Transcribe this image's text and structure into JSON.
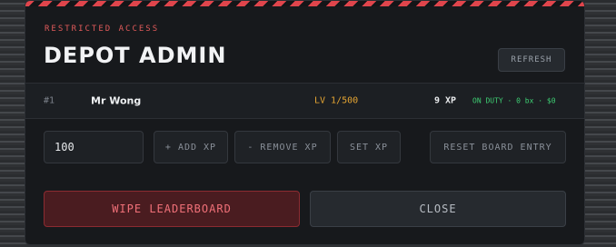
{
  "header": {
    "eyebrow": "RESTRICTED ACCESS",
    "title": "DEPOT ADMIN",
    "refresh_label": "REFRESH"
  },
  "entries": [
    {
      "rank": "#1",
      "name": "Mr Wong",
      "level": "LV 1/500",
      "xp": "9 XP",
      "status": "ON DUTY · 0 bx · $0"
    }
  ],
  "controls": {
    "amount_value": "100",
    "add_label": "+ ADD XP",
    "remove_label": "- REMOVE XP",
    "set_label": "SET XP",
    "reset_label": "RESET BOARD ENTRY"
  },
  "footer": {
    "wipe_label": "WIPE LEADERBOARD",
    "close_label": "CLOSE"
  },
  "colors": {
    "accent_red": "#e0454c",
    "level_orange": "#e6a633",
    "status_green": "#3ecf73"
  }
}
